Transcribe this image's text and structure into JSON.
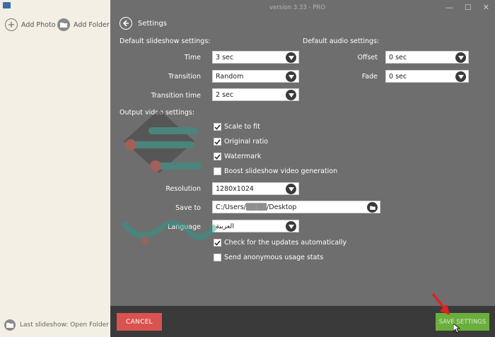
{
  "left_panel": {
    "add_photo": "Add Photo",
    "add_folder": "Add Folder",
    "last_slideshow": "Last slideshow: Open Folder"
  },
  "title_bar": {
    "version": "version 3.33 - PRO"
  },
  "header": {
    "title": "Settings"
  },
  "slideshow": {
    "section_title": "Default slideshow settings:",
    "time_label": "Time",
    "time_value": "3 sec",
    "transition_label": "Transition",
    "transition_value": "Random",
    "transition_time_label": "Transition time",
    "transition_time_value": "2 sec"
  },
  "audio": {
    "section_title": "Default audio settings:",
    "offset_label": "Offset",
    "offset_value": "0 sec",
    "fade_label": "Fade",
    "fade_value": "0 sec"
  },
  "output": {
    "section_title": "Output video settings:",
    "scale_to_fit": "Scale to fit",
    "original_ratio": "Original ratio",
    "watermark": "Watermark",
    "boost": "Boost slideshow video generation",
    "resolution_label": "Resolution",
    "resolution_value": "1280x1024",
    "save_to_label": "Save to",
    "save_to_value": "C:/Users/▒▒▒▒/Desktop",
    "language_label": "Language",
    "language_value": "العربية",
    "check_updates": "Check for the updates automatically",
    "send_stats": "Send anonymous usage stats"
  },
  "checks": {
    "scale_to_fit": true,
    "original_ratio": true,
    "watermark": true,
    "boost": false,
    "check_updates": true,
    "send_stats": false
  },
  "buttons": {
    "cancel": "CANCEL",
    "save": "SAVE SETTINGS"
  },
  "colors": {
    "cancel": "#d9534f",
    "save": "#6aae3e",
    "bottom_bar": "#3a3a3a",
    "main_bg": "#6e6e6e"
  }
}
